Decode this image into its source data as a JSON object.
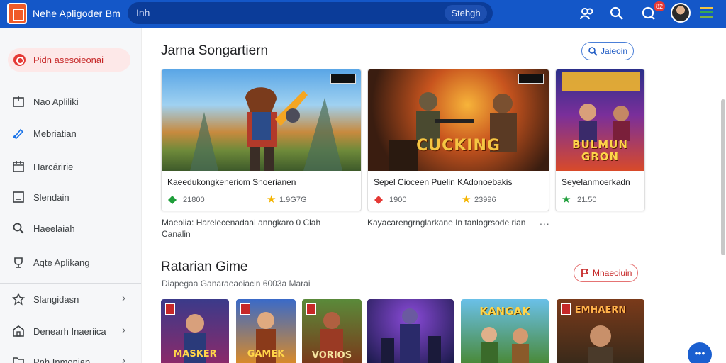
{
  "app": {
    "title": "Nehe Apligoder Bm",
    "brand_color": "#1457c8"
  },
  "search": {
    "value": "Inh",
    "button_label": "Stehgh"
  },
  "topbar": {
    "icons": [
      "people-icon",
      "search-icon",
      "chat-icon",
      "avatar",
      "apps-icon"
    ],
    "notification_badge": "82"
  },
  "sidebar": {
    "active": {
      "label": "Pidn asesoieonai",
      "icon": "discover-icon"
    },
    "items": [
      {
        "label": "Nao Apliliki",
        "icon": "games-icon"
      },
      {
        "label": "Mebriatian",
        "icon": "brush-icon"
      },
      {
        "label": "Harcáririe",
        "icon": "calendar-icon"
      },
      {
        "label": "Slendain",
        "icon": "layout-icon"
      },
      {
        "label": "Haeelaiah",
        "icon": "search-icon"
      },
      {
        "label": "Aqte Aplikang",
        "icon": "trophy-icon"
      },
      {
        "label": "Slangidasn",
        "icon": "star-icon"
      },
      {
        "label": "Denearh Inaeriica",
        "icon": "store-icon"
      },
      {
        "label": "Pnh Inmonian",
        "icon": "folder-icon"
      }
    ]
  },
  "section1": {
    "title": "Jarna Songartiern",
    "button_label": "Jaieoin",
    "cards": [
      {
        "caption": "Kaeedukongkeneriom Snoerianen",
        "stat1": "21800",
        "stat2": "1.9G7G",
        "badge_color": "#1e9e3a",
        "art_text": ""
      },
      {
        "caption": "Sepel Cioceen Puelin KAdonoebakis",
        "stat1": "1900",
        "stat2": "23996",
        "badge_color": "#e53935",
        "art_text": "CUCKING"
      },
      {
        "caption": "Seyelanmoerkadn",
        "stat1": "21.50",
        "stat2": "",
        "badge_color": "#1e9e3a",
        "art_text": "BULMUN GRON"
      }
    ],
    "descriptions": [
      "Maeolia: Harelecenadaal anngkaro 0 Clah Canalin",
      "Kayacarengrnglarkane In tanlogrsode rian"
    ],
    "more": "..."
  },
  "section2": {
    "title": "Ratarian Gime",
    "subtitle": "Diapegaa Ganaraeaoiacin 6003a Marai",
    "button_label": "Mnaeoiuin",
    "tiles": [
      {
        "art_text": "MASKER"
      },
      {
        "art_text": "GAMEK"
      },
      {
        "art_text": "VORIOS"
      },
      {
        "art_text": ""
      },
      {
        "art_text": "KANGAK"
      },
      {
        "art_text": "EMHAERN"
      }
    ]
  },
  "fab": {
    "icon": "more-icon",
    "label": "•••"
  }
}
